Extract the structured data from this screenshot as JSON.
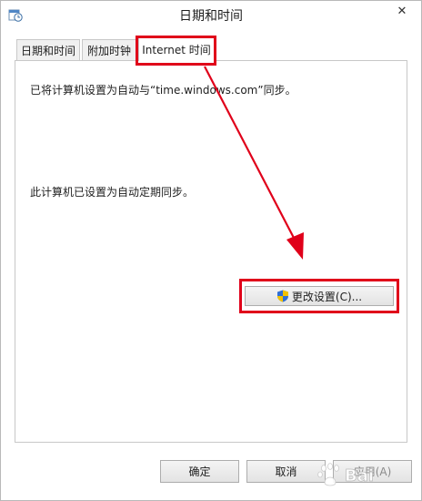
{
  "window": {
    "title": "日期和时间",
    "close_glyph": "✕"
  },
  "tabs": [
    {
      "label": "日期和时间",
      "active": false
    },
    {
      "label": "附加时钟",
      "active": false
    },
    {
      "label": "Internet 时间",
      "active": true
    }
  ],
  "panel": {
    "sync_status": "已将计算机设置为自动与“time.windows.com”同步。",
    "schedule_status": "此计算机已设置为自动定期同步。",
    "change_settings_label": "更改设置(C)..."
  },
  "buttons": {
    "ok_label": "确定",
    "cancel_label": "取消",
    "apply_label": "应用(A)"
  },
  "watermark": {
    "text": "Bai"
  },
  "colors": {
    "highlight": "#e0001a",
    "shield_blue": "#2f6fd6",
    "shield_yellow": "#f2c200"
  },
  "icons": [
    "date-time-icon",
    "close-icon",
    "uac-shield-icon"
  ]
}
